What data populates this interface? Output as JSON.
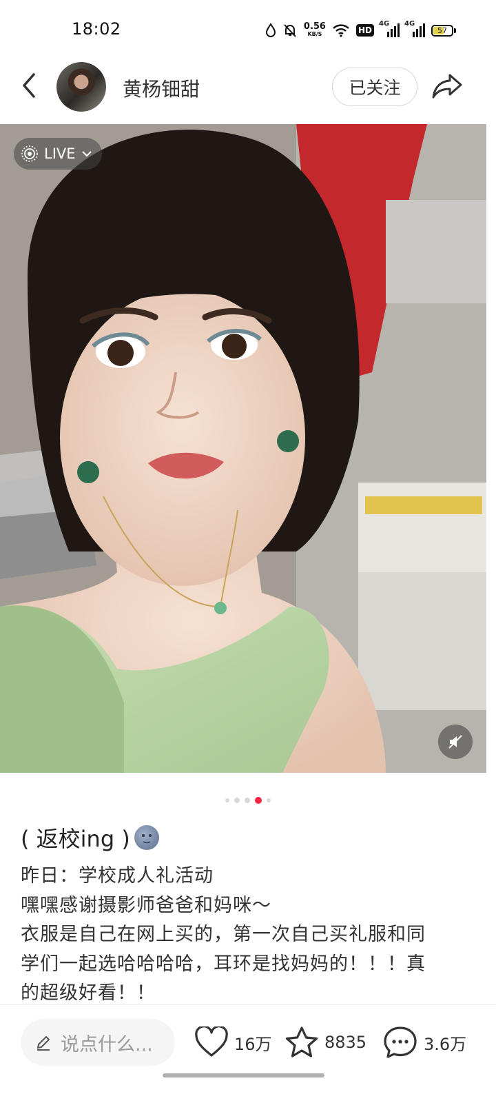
{
  "status_bar": {
    "time": "18:02",
    "net_speed_value": "0.56",
    "net_speed_unit": "KB/S",
    "hd_label": "HD",
    "signal_1_label": "4G",
    "signal_2_label": "4G",
    "battery_percent": "57"
  },
  "header": {
    "author_name": "黄杨钿甜",
    "follow_label": "已关注"
  },
  "media": {
    "live_label": "LIVE",
    "carousel_total": 5,
    "carousel_active_index": 4
  },
  "note": {
    "title": "( 返校ing )",
    "title_emoji": "new-moon-face",
    "body_lines": [
      "昨日：学校成人礼活动",
      "嘿嘿感谢摄影师爸爸和妈咪～",
      "衣服是自己在网上买的，第一次自己买礼服和同",
      "学们一起选哈哈哈哈，耳环是找妈妈的！！！真",
      "的超级好看！！"
    ]
  },
  "bottom_bar": {
    "comment_placeholder": "说点什么...",
    "likes": "16万",
    "collects": "8835",
    "comments": "3.6万"
  },
  "colors": {
    "accent": "#ff2442",
    "text_primary": "#333333",
    "placeholder": "#999999"
  }
}
